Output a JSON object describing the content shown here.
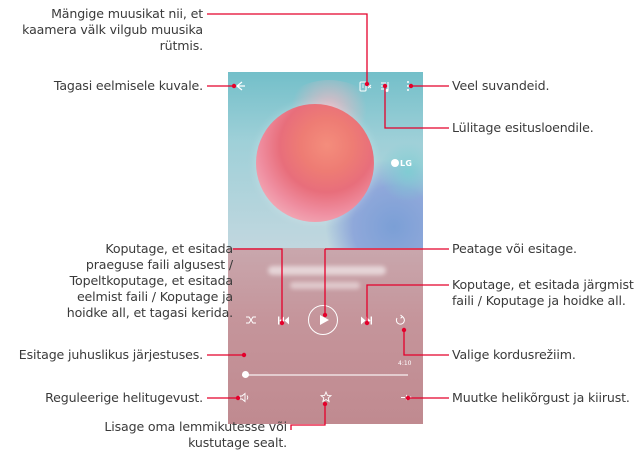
{
  "callouts": {
    "flash": [
      "Mängige muusikat nii, et",
      "kaamera välk vilgub muusika",
      "rütmis."
    ],
    "back": [
      "Tagasi eelmisele kuvale."
    ],
    "more": [
      "Veel suvandeid."
    ],
    "playlist": [
      "Lülitage esitusloendile."
    ],
    "rewind": [
      "Koputage, et esitada",
      "praeguse faili algusest /",
      "Topeltkoputage, et esitada",
      "eelmist faili / Koputage ja",
      "hoidke all, et tagasi kerida."
    ],
    "play": [
      "Peatage või esitage."
    ],
    "forward": [
      "Koputage, et esitada järgmist",
      "faili / Koputage ja hoidke all."
    ],
    "shuffle": [
      "Esitage juhuslikus järjestuses."
    ],
    "repeat": [
      "Valige kordusrežiim."
    ],
    "volume": [
      "Reguleerige helitugevust."
    ],
    "effects": [
      "Muutke helikõrgust ja kiirust."
    ],
    "favorite": [
      "Lisage oma lemmikutesse või",
      "kustutage sealt."
    ]
  },
  "phone": {
    "logo_text": "LG",
    "total_time": "4:10",
    "progress_fraction": 0.02,
    "icons": {
      "back": "back-arrow-icon",
      "flash": "flash-music-icon",
      "playlist": "playlist-icon",
      "more": "more-options-icon",
      "shuffle": "shuffle-icon",
      "rewind": "rewind-icon",
      "play": "play-icon",
      "forward": "fast-forward-icon",
      "repeat": "repeat-icon",
      "volume": "volume-icon",
      "favorite": "favorite-star-icon",
      "effects": "sound-effects-icon"
    }
  },
  "colors": {
    "leader": "#e4002b",
    "dot": "#e4002b",
    "text": "#3a3a3a"
  }
}
